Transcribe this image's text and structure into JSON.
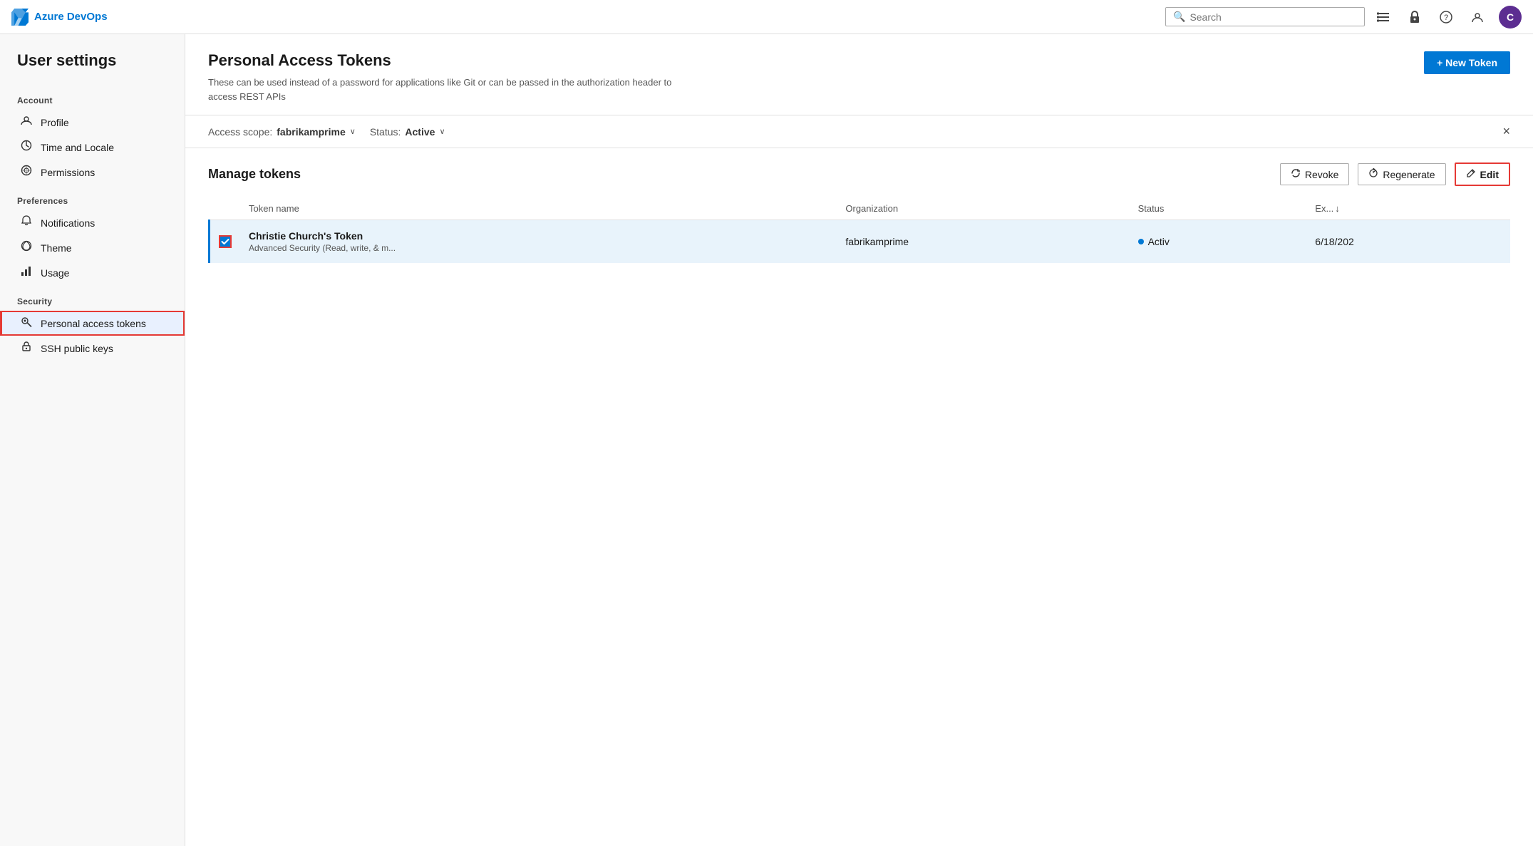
{
  "topnav": {
    "logo_text": "Azure DevOps",
    "search_placeholder": "Search"
  },
  "sidebar": {
    "title": "User settings",
    "sections": [
      {
        "label": "Account",
        "items": [
          {
            "id": "profile",
            "icon": "👤",
            "label": "Profile"
          },
          {
            "id": "time-locale",
            "icon": "🌐",
            "label": "Time and Locale"
          },
          {
            "id": "permissions",
            "icon": "🔄",
            "label": "Permissions"
          }
        ]
      },
      {
        "label": "Preferences",
        "items": [
          {
            "id": "notifications",
            "icon": "🔔",
            "label": "Notifications"
          },
          {
            "id": "theme",
            "icon": "🎨",
            "label": "Theme"
          },
          {
            "id": "usage",
            "icon": "📊",
            "label": "Usage"
          }
        ]
      },
      {
        "label": "Security",
        "items": [
          {
            "id": "personal-access-tokens",
            "icon": "🔑",
            "label": "Personal access tokens",
            "active": true
          },
          {
            "id": "ssh-public-keys",
            "icon": "🔒",
            "label": "SSH public keys"
          }
        ]
      }
    ]
  },
  "page": {
    "title": "Personal Access Tokens",
    "description": "These can be used instead of a password for applications like Git or can be passed in the authorization header to access REST APIs",
    "new_token_label": "+ New Token",
    "filter": {
      "scope_label": "Access scope:",
      "scope_value": "fabrikamprime",
      "status_label": "Status:",
      "status_value": "Active"
    },
    "manage": {
      "title": "Manage tokens",
      "revoke_label": "Revoke",
      "regenerate_label": "Regenerate",
      "edit_label": "Edit"
    },
    "table": {
      "columns": [
        {
          "id": "checkbox",
          "label": ""
        },
        {
          "id": "token_name",
          "label": "Token name"
        },
        {
          "id": "organization",
          "label": "Organization"
        },
        {
          "id": "status",
          "label": "Status"
        },
        {
          "id": "expiry",
          "label": "Ex...",
          "sortable": true
        }
      ],
      "rows": [
        {
          "selected": true,
          "name": "Christie Church's Token",
          "description": "Advanced Security (Read, write, & m...",
          "organization": "fabrikamprime",
          "status": "Activ",
          "expiry": "6/18/202"
        }
      ]
    }
  },
  "icons": {
    "search": "🔍",
    "list": "☰",
    "lock": "🔒",
    "help": "?",
    "settings": "⚙",
    "chevron_down": "∨",
    "close": "×",
    "revoke": "↩",
    "regenerate": "↻",
    "edit": "✏",
    "check": "✓",
    "sort_desc": "↓"
  }
}
